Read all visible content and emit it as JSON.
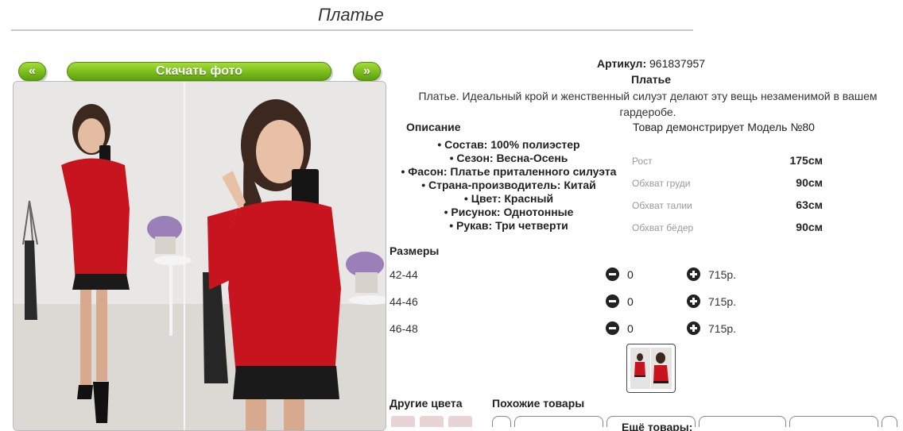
{
  "page": {
    "title": "Платье"
  },
  "gallery": {
    "prev_label": "«",
    "download_label": "Скачать фото",
    "next_label": "»"
  },
  "product": {
    "article_label": "Артикул:",
    "article_value": "961837957",
    "name": "Платье",
    "description": "Платье. Идеальный крой и женственный силуэт делают эту вещь незаменимой в вашем гардеробе."
  },
  "specs": {
    "heading": "Описание",
    "items": [
      "• Состав: 100% полиэстер",
      "• Сезон: Весна-Осень",
      "• Фасон: Платье приталенного силуэта",
      "• Страна-производитель: Китай",
      "• Цвет: Красный",
      "• Рисунок: Однотонные",
      "• Рукав: Три четверти"
    ]
  },
  "model": {
    "line": "Товар демонстрирует Модель №80",
    "measurements": [
      {
        "label": "Рост",
        "value": "175см"
      },
      {
        "label": "Обхват груди",
        "value": "90см"
      },
      {
        "label": "Обхват талии",
        "value": "63см"
      },
      {
        "label": "Обхват бёдер",
        "value": "90см"
      }
    ]
  },
  "sizes": {
    "heading": "Размеры",
    "rows": [
      {
        "size": "42-44",
        "qty": "0",
        "price": "715р."
      },
      {
        "size": "44-46",
        "qty": "0",
        "price": "715р."
      },
      {
        "size": "46-48",
        "qty": "0",
        "price": "715р."
      }
    ]
  },
  "bottom": {
    "other_colors": "Другие цвета",
    "similar": "Похожие товары",
    "more": "Ещё товары:"
  },
  "colors": {
    "accent_green": "#7cbf1e",
    "dress_red": "#c8141e",
    "lace_black": "#1a1a1a"
  }
}
